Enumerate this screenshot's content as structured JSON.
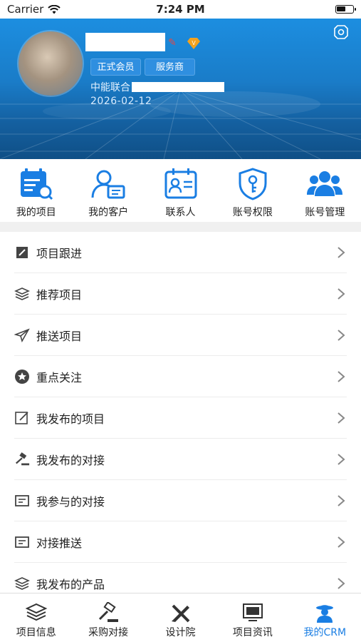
{
  "status_bar": {
    "carrier": "Carrier",
    "time": "7:24 PM"
  },
  "profile": {
    "tags": [
      "正式会员",
      "服务商"
    ],
    "company_prefix": "中能联合",
    "date": "2026-02-12"
  },
  "quick_actions": [
    {
      "label": "我的项目",
      "icon": "calendar-search-icon"
    },
    {
      "label": "我的客户",
      "icon": "customer-card-icon"
    },
    {
      "label": "联系人",
      "icon": "contact-card-icon"
    },
    {
      "label": "账号权限",
      "icon": "shield-key-icon"
    },
    {
      "label": "账号管理",
      "icon": "users-group-icon"
    }
  ],
  "menu": [
    {
      "label": "项目跟进",
      "icon": "edit-box-icon"
    },
    {
      "label": "推荐项目",
      "icon": "layers-icon"
    },
    {
      "label": "推送项目",
      "icon": "paper-plane-icon"
    },
    {
      "label": "重点关注",
      "icon": "star-circle-icon"
    },
    {
      "label": "我发布的项目",
      "icon": "edit-square-icon"
    },
    {
      "label": "我发布的对接",
      "icon": "gavel-icon"
    },
    {
      "label": "我参与的对接",
      "icon": "chat-box-icon"
    },
    {
      "label": "对接推送",
      "icon": "chat-box-icon"
    },
    {
      "label": "我发布的产品",
      "icon": "layers-icon"
    }
  ],
  "tabs": [
    {
      "label": "项目信息",
      "icon": "layers-icon",
      "active": false
    },
    {
      "label": "采购对接",
      "icon": "gavel-icon",
      "active": false
    },
    {
      "label": "设计院",
      "icon": "pencil-ruler-icon",
      "active": false
    },
    {
      "label": "项目资讯",
      "icon": "monitor-icon",
      "active": false
    },
    {
      "label": "我的CRM",
      "icon": "person-hat-icon",
      "active": true
    }
  ],
  "colors": {
    "primary": "#1a7ee3",
    "banner": "#1a7cc8"
  }
}
